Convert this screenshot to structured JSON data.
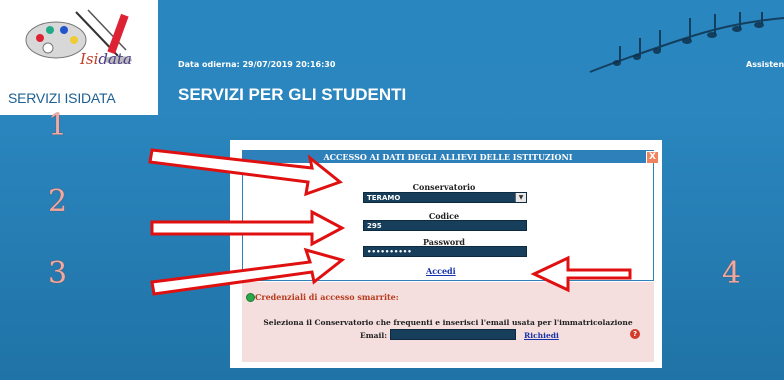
{
  "header": {
    "logo_word_prefix": "Isi",
    "logo_word_suffix": "data",
    "logo_caption": "SERVIZI ISIDATA",
    "date_line": "Data odierna: 29/07/2019 20:16:30",
    "assistance": "Assisten",
    "page_title": "SERVIZI PER GLI STUDENTI"
  },
  "markers": [
    "1",
    "2",
    "3",
    "4"
  ],
  "dialog": {
    "title": "ACCESSO AI DATI DEGLI ALLIEVI DELLE ISTITUZIONI",
    "close_label": "X",
    "conservatorio_label": "Conservatorio",
    "conservatorio_value": "TERAMO",
    "codice_label": "Codice",
    "codice_value": "295",
    "password_label": "Password",
    "password_value": "••••••••••",
    "login_label": "Accedi"
  },
  "lost_credentials": {
    "title": "Credenziali di accesso smarrite:",
    "instructions": "Seleziona il Conservatorio che frequenti e inserisci l'email usata per l'immatricolazione",
    "email_label": "Email:",
    "request_label": "Richiedi",
    "help_label": "?"
  },
  "colors": {
    "page_blue": "#2a86bf",
    "field_navy": "#173f5c",
    "link_blue": "#1733a8",
    "alert_red": "#b83b1e",
    "annotation_red": "#e01010",
    "lost_box_pink": "#f4dede"
  },
  "icons": [
    "palette-logo-icon",
    "music-notes-icon",
    "close-icon",
    "green-circle-icon",
    "help-icon",
    "dropdown-arrow-icon",
    "red-arrow-icon"
  ]
}
